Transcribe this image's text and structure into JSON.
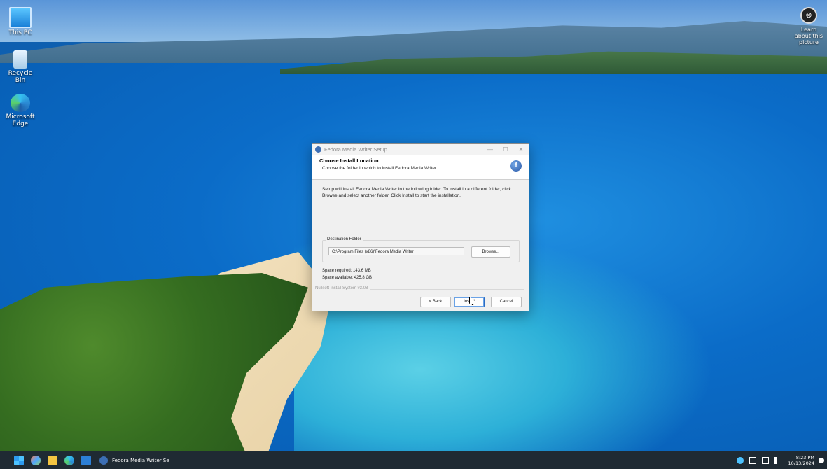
{
  "desktop": {
    "icons": [
      {
        "label": "This PC"
      },
      {
        "label": "Recycle Bin"
      },
      {
        "label": "Microsoft Edge"
      }
    ],
    "learn_picture": "Learn about this picture"
  },
  "installer": {
    "window_title": "Fedora Media Writer Setup",
    "heading": "Choose Install Location",
    "subheading": "Choose the folder in which to install Fedora Media Writer.",
    "instructions": "Setup will install Fedora Media Writer in the following folder. To install in a different folder, click Browse and select another folder. Click Install to start the installation.",
    "destination_legend": "Destination Folder",
    "destination_value": "C:\\Program Files (x86)\\Fedora Media Writer",
    "browse_label": "Browse...",
    "space_required": "Space required: 143.6 MB",
    "space_available": "Space available: 425.8 GB",
    "branding": "Nullsoft Install System v3.08",
    "back_label": "< Back",
    "install_label": "Install",
    "cancel_label": "Cancel",
    "minimize": "—",
    "maximize": "☐",
    "close": "✕"
  },
  "taskbar": {
    "running_app": "Fedora Media Writer Se",
    "time": "8:23 PM",
    "date": "10/13/2024"
  }
}
